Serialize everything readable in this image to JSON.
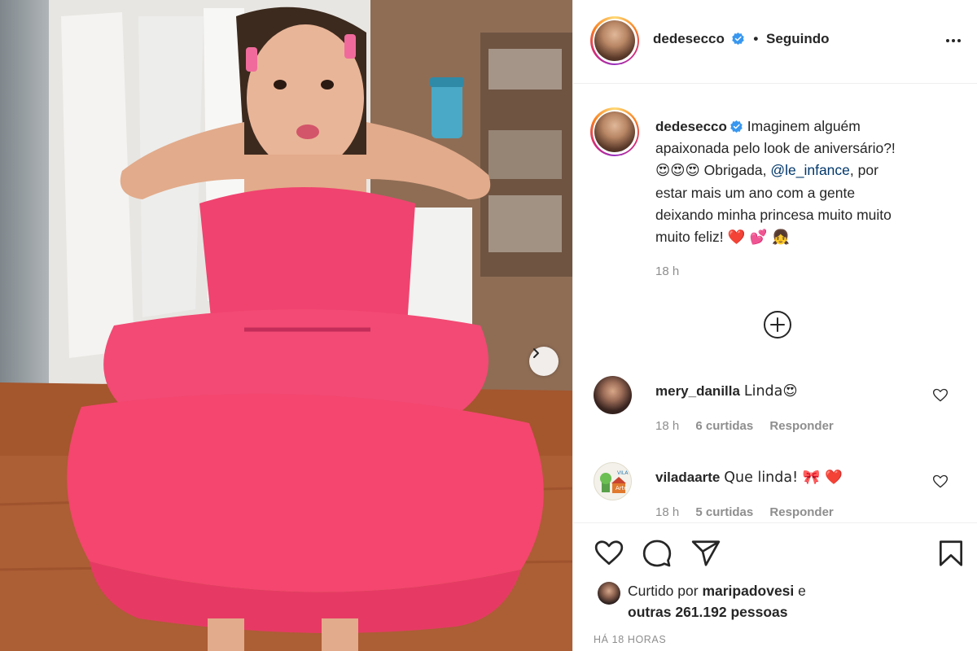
{
  "post": {
    "author": "dedesecco",
    "follow_separator": "•",
    "follow_status": "Seguindo",
    "caption": {
      "line1": "Imaginem alguém",
      "line2": "apaixonada pelo look de aniversário?!",
      "emojis_start": "😍😍😍",
      "thanks": "Obrigada,",
      "mention": "@le_infance",
      "after_mention": ", por",
      "line4": "estar mais um ano com a gente",
      "line5": "deixando minha princesa muito muito",
      "line6": "muito feliz!",
      "emojis_end": "❤️ 💕 👧"
    },
    "caption_time": "18 h"
  },
  "comments": [
    {
      "user": "mery_danilla",
      "text": "Linda😍",
      "time": "18 h",
      "likes": "6 curtidas",
      "reply": "Responder"
    },
    {
      "user": "viladaarte",
      "text": "Que linda! 🎀 ❤️",
      "time": "18 h",
      "likes": "5 curtidas",
      "reply": "Responder"
    }
  ],
  "engagement": {
    "liked_prefix": "Curtido por",
    "liked_user": "maripadovesi",
    "liked_and": "e",
    "liked_others": "outras 261.192 pessoas",
    "timestamp": "HÁ 18 HORAS"
  },
  "vila_logo": {
    "small": "VILA",
    "big": "Arte"
  },
  "icons": {
    "header_more": "more-horizontal-icon",
    "verified": "verified-badge-icon",
    "load_more": "plus-circle-icon",
    "next": "chevron-right-icon",
    "like": "heart-outline-icon",
    "comment": "speech-bubble-icon",
    "share": "paper-plane-icon",
    "save": "bookmark-icon"
  },
  "colors": {
    "verified": "#3897f0",
    "mention": "#00376b",
    "muted": "#8e8e8e",
    "dress": "#f2416f"
  }
}
